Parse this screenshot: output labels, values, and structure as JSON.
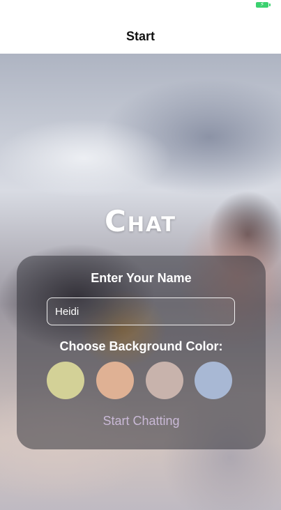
{
  "status_bar": {
    "battery_icon": "battery-charging-icon",
    "battery_color": "#3bd16f"
  },
  "nav": {
    "title": "Start"
  },
  "app": {
    "title": "Chat"
  },
  "form": {
    "name_label": "Enter Your Name",
    "name_value": "Heidi",
    "color_label": "Choose Background Color:",
    "colors": [
      "#d3d197",
      "#dfb194",
      "#c8b3ac",
      "#a8b8d4"
    ],
    "start_label": "Start Chatting"
  }
}
